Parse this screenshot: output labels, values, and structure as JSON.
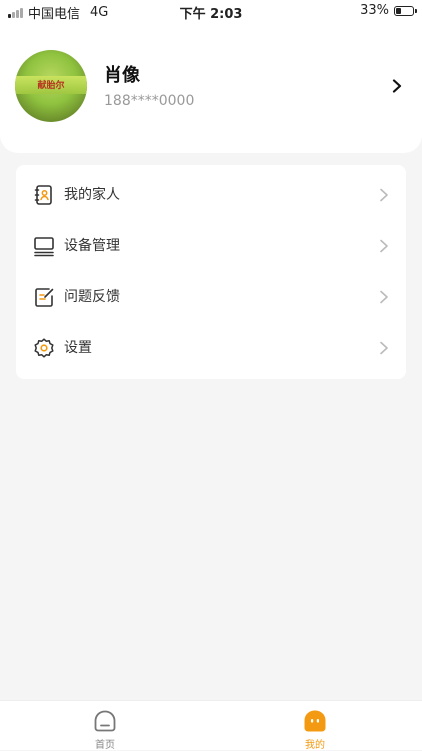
{
  "status_bar": {
    "carrier": "中国电信",
    "network": "4G",
    "time": "下午 2:03",
    "battery_text": "33%",
    "battery_level": 0.33
  },
  "profile": {
    "avatar_text": "献胎尔",
    "username": "肖像",
    "phone": "188****0000"
  },
  "menu": {
    "items": [
      {
        "label": "我的家人",
        "icon": "address-book-icon"
      },
      {
        "label": "设备管理",
        "icon": "device-icon"
      },
      {
        "label": "问题反馈",
        "icon": "feedback-icon"
      },
      {
        "label": "设置",
        "icon": "gear-icon"
      }
    ]
  },
  "tabbar": {
    "home_label": "首页",
    "me_label": "我的",
    "active": "me"
  },
  "colors": {
    "accent": "#f39a12",
    "background": "#f5f5f5"
  }
}
